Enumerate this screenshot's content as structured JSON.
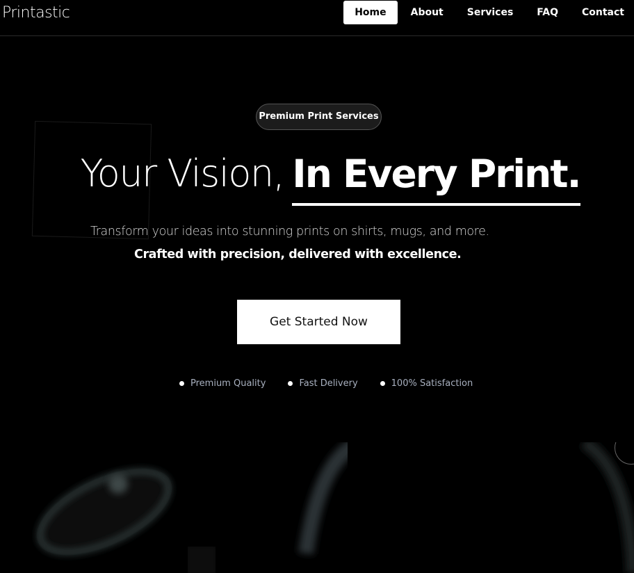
{
  "nav": {
    "brand": "Printastic",
    "links": [
      {
        "label": "Home",
        "active": true
      },
      {
        "label": "About",
        "active": false
      },
      {
        "label": "Services",
        "active": false
      },
      {
        "label": "FAQ",
        "active": false
      },
      {
        "label": "Contact",
        "active": false
      }
    ]
  },
  "hero": {
    "badge": "Premium Print Services",
    "headline_light": "Your Vision,",
    "headline_bold": "In Every Print.",
    "subtitle_line1": "Transform your ideas into stunning prints on shirts, mugs, and more.",
    "subtitle_line2": "Crafted with precision, delivered with excellence.",
    "cta_label": "Get Started Now",
    "features": [
      {
        "label": "Premium Quality"
      },
      {
        "label": "Fast Delivery"
      },
      {
        "label": "100% Satisfaction"
      }
    ]
  },
  "colors": {
    "background": "#000000",
    "accent": "#ffffff",
    "feature_text": "#a8b0bf",
    "badge_bg": "#1c1c1c"
  }
}
